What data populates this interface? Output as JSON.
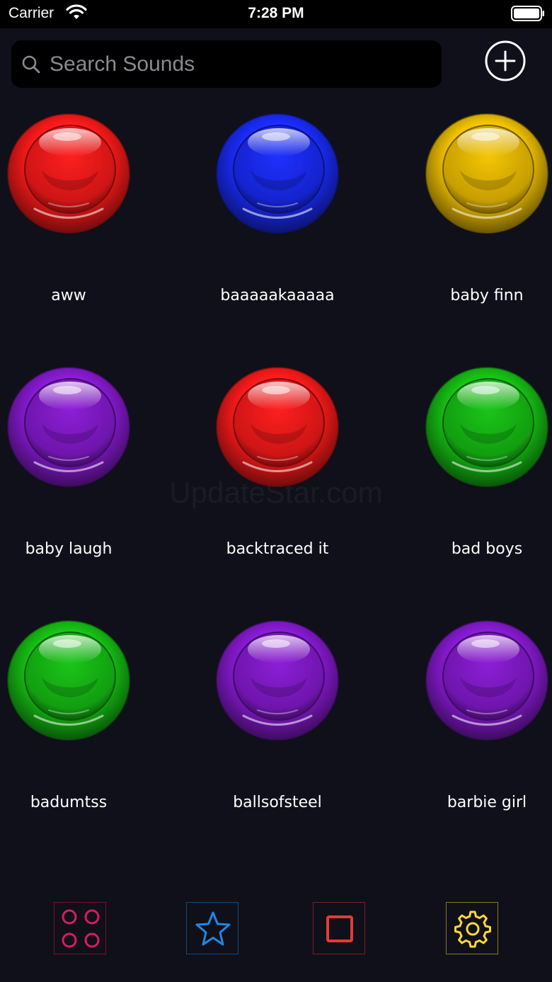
{
  "status_bar": {
    "carrier": "Carrier",
    "time": "7:28 PM"
  },
  "search": {
    "placeholder": "Search Sounds",
    "value": ""
  },
  "sounds": [
    {
      "label": "aww",
      "color": "#ff1a1a"
    },
    {
      "label": "baaaaakaaaaa",
      "color": "#1a2cff"
    },
    {
      "label": "baby finn",
      "color": "#f5c400"
    },
    {
      "label": "baby laugh",
      "color": "#8a1ad6"
    },
    {
      "label": "backtraced it",
      "color": "#ff1a1a"
    },
    {
      "label": "bad boys",
      "color": "#16c414"
    },
    {
      "label": "badumtss",
      "color": "#16c414"
    },
    {
      "label": "ballsofsteel",
      "color": "#8a1ad6"
    },
    {
      "label": "barbie girl",
      "color": "#8a1ad6"
    }
  ],
  "watermark": "UpdateStar.com",
  "tabs": [
    {
      "name": "grid-icon",
      "color": "#d81b60"
    },
    {
      "name": "star-icon",
      "color": "#1e88e5"
    },
    {
      "name": "stop-icon",
      "color": "#e53935"
    },
    {
      "name": "gear-icon",
      "color": "#fdd835"
    }
  ]
}
